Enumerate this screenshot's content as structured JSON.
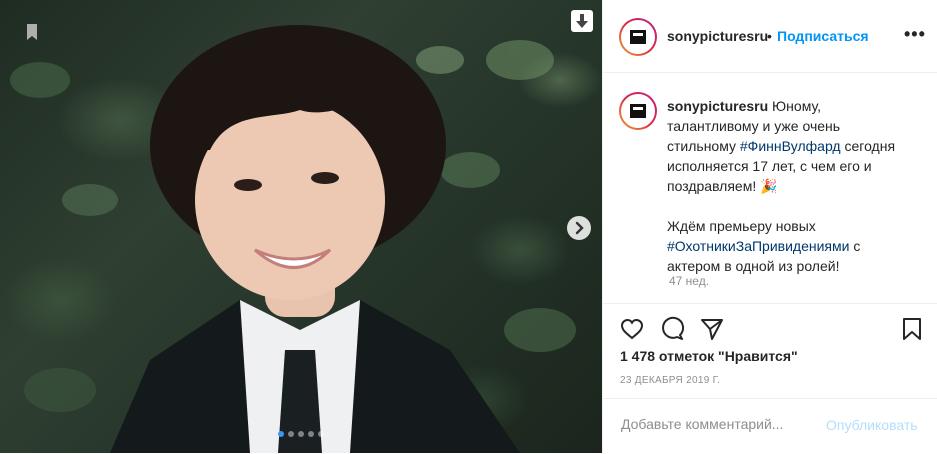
{
  "post": {
    "username": "sonypicturesru",
    "dot": "•",
    "follow_label": "Подписаться",
    "more_label": "•••",
    "caption": {
      "text_1": "Юному, талантливому и уже очень стильному",
      "hashtag_1": "#ФиннВулфард",
      "text_2": "сегодня исполняется 17 лет, с чем его и поздравляем! 🎉",
      "text_3": "Ждём премьеру новых",
      "hashtag_2": "#ОхотникиЗаПривидениями",
      "text_4": "с актером в одной из ролей!"
    },
    "time_ago": "47 нед.",
    "likes": "1 478 отметок \"Нравится\"",
    "date": "23 ДЕКАБРЯ 2019 Г.",
    "comment_placeholder": "Добавьте комментарий...",
    "publish_label": "Опубликовать"
  },
  "carousel": {
    "dots": 5,
    "active_index": 0
  },
  "icons": [
    "bookmark-icon",
    "download-icon",
    "next-arrow-icon",
    "like-icon",
    "comment-icon",
    "share-icon",
    "save-icon",
    "more-icon"
  ],
  "colors": {
    "link": "#0095f6",
    "hashtag": "#00376b",
    "muted": "#8e8e8e"
  }
}
